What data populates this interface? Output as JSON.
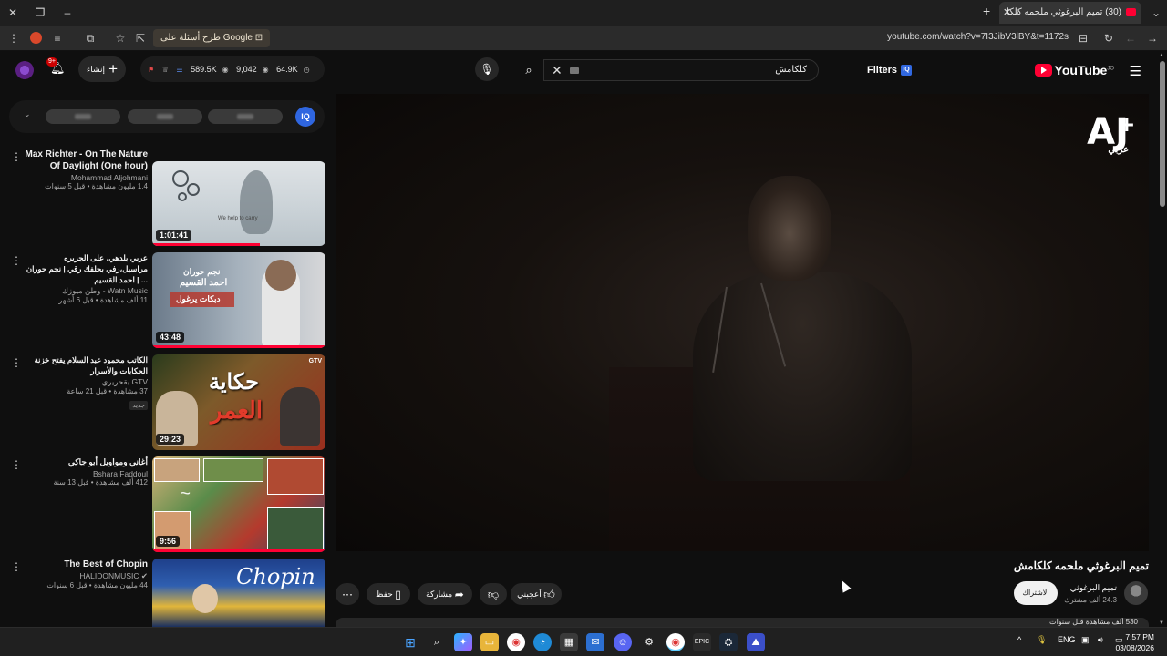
{
  "browser": {
    "tab_title": "(30) تميم البرغوثي ملحمه كلكا",
    "url": "youtube.com/watch?v=7I3JibV3lBY&t=1172s",
    "google_pill": "طرح أسئلة على Google",
    "ext_badge": "!"
  },
  "header": {
    "logo_text": "YouTube",
    "logo_sup": "JO",
    "filters_label": "Filters",
    "filters_badge": "IQ",
    "search_value": "كلكامش",
    "create_label": "إنشاء",
    "bell_count": "9+",
    "stats": {
      "views": "589.5K",
      "mid": "9,042",
      "right": "64.9K"
    }
  },
  "chips": {
    "iq_label": "IQ"
  },
  "related": [
    {
      "title": "Max Richter - On The Nature Of Daylight (One hour)",
      "channel": "Mohammad Aljohmani",
      "meta": "1.4 مليون مشاهدة • قبل 5 سنوات",
      "duration": "1:01:41",
      "watched": 0.62,
      "badge": ""
    },
    {
      "title": "عربي بلدهي، على الجزيره_ مراسيل،رفي بحلفك رقي | نجم حوران احمد القسيم | ...",
      "channel": "وطن ميوزك - Watn Music",
      "meta": "11 ألف مشاهدة • قبل 6 أشهر",
      "duration": "43:48",
      "watched": 1.0,
      "badge": ""
    },
    {
      "title": "الكاتب محمود عبد السلام يفتح خزنة الحكايات والأسرار",
      "channel": "بقحريري GTV",
      "meta": "37 مشاهدة • قبل 21 ساعة",
      "duration": "29:23",
      "watched": 0,
      "badge": "جديد"
    },
    {
      "title": "أغاني ومواويل أبو جاكي",
      "channel": "Bshara Faddoul",
      "meta": "412 ألف مشاهدة • قبل 13 سنة",
      "duration": "9:56",
      "watched": 1.0,
      "badge": ""
    },
    {
      "title": "The Best of Chopin",
      "channel": "HALIDONMUSIC",
      "meta": "44 مليون مشاهدة • قبل 6 سنوات",
      "duration": "",
      "watched": 0,
      "badge": ""
    }
  ],
  "thumb_text": {
    "t2_top": "نجم حوران",
    "t2_name": "احمد القسيم",
    "t2_banner": "دبكات يرغول",
    "t3_line1": "حكاية",
    "t3_line2": "العمر",
    "t3_tag": "GTV",
    "t5_word": "Chopin",
    "t1_caption": "We help to carry"
  },
  "player": {
    "logo_main": "AJ",
    "logo_plus": "+",
    "logo_sub": "عربي"
  },
  "video": {
    "title": "تميم البرغوثي ملحمه كلكامش",
    "channel": "تميم البرغوثي",
    "subs": "24.3 ألف مشترك",
    "subscribe": "الاشتراك",
    "like": "أعجبني",
    "share": "مشاركة",
    "save": "حفظ",
    "desc_peek": "530 ألف مشاهدة قبل سنوات"
  },
  "taskbar": {
    "lang": "ENG",
    "time": "7:57 PM",
    "date": "03/08/2026"
  }
}
